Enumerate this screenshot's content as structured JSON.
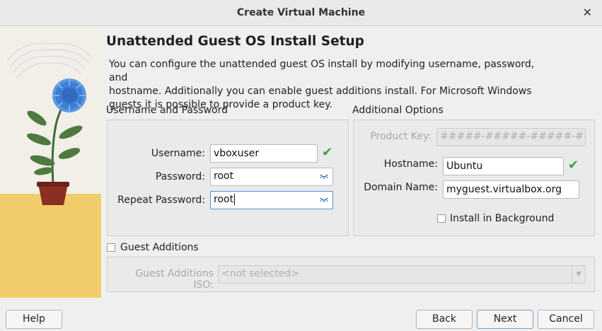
{
  "window": {
    "title": "Create Virtual Machine",
    "close_glyph": "✕"
  },
  "heading": "Unattended Guest OS Install Setup",
  "description": {
    "line1": "You can configure the unattended guest OS install by modifying username, password, and",
    "line2": "hostname. Additionally you can enable guest additions install. For Microsoft Windows",
    "line3": "guests it is possible to provide a product key."
  },
  "credentials": {
    "group_title": "Username and Password",
    "username_label": "Username:",
    "username_value": "vboxuser",
    "password_label": "Password:",
    "password_value": "root",
    "repeat_label": "Repeat Password:",
    "repeat_value": "root"
  },
  "options": {
    "group_title": "Additional Options",
    "product_key_label": "Product Key:",
    "product_key_value": "#####-#####-#####-#####",
    "hostname_label": "Hostname:",
    "hostname_value": "Ubuntu",
    "domain_label": "Domain Name:",
    "domain_value": "myguest.virtualbox.org",
    "install_bg_label": "Install in Background",
    "install_bg_checked": false
  },
  "guest_additions": {
    "label": "Guest Additions",
    "checked": false,
    "iso_label": "Guest Additions ISO:",
    "iso_value": "<not selected>"
  },
  "buttons": {
    "help": "Help",
    "back": "Back",
    "next": "Next",
    "cancel": "Cancel"
  },
  "colors": {
    "accent": "#4a90d9",
    "valid_check": "#3aa53a",
    "flower": "#3d7fd6",
    "pot": "#8a2f22",
    "ground": "#f0cd6a"
  }
}
